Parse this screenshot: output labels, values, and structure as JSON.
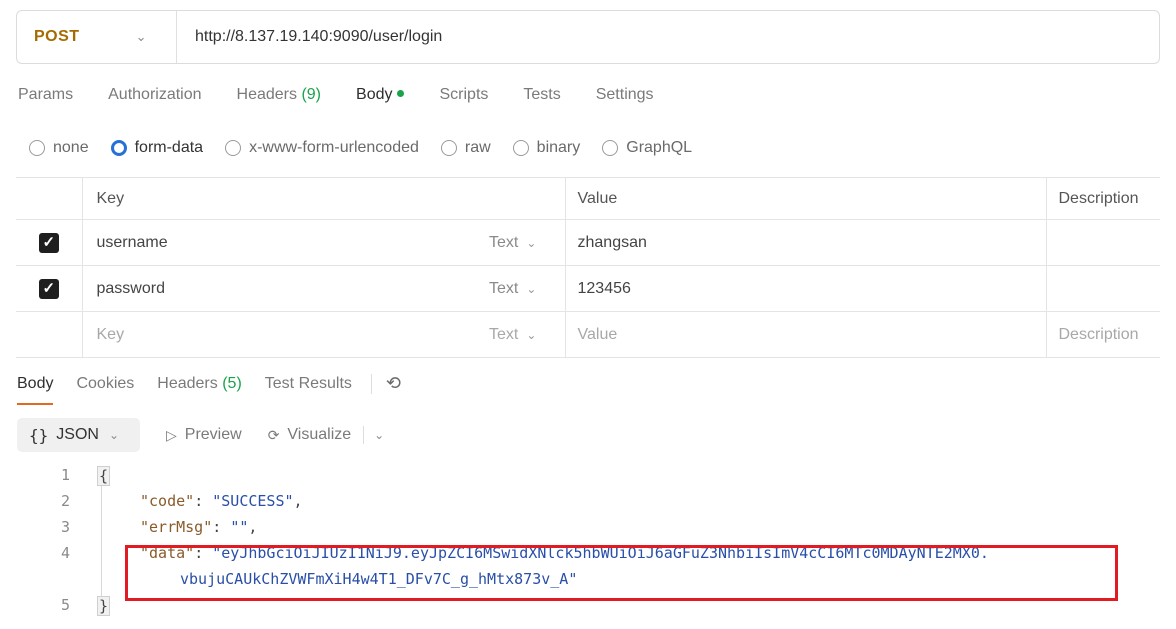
{
  "request": {
    "method": "POST",
    "url": "http://8.137.19.140:9090/user/login"
  },
  "request_tabs": [
    {
      "label": "Params"
    },
    {
      "label": "Authorization"
    },
    {
      "label": "Headers",
      "count": "(9)"
    },
    {
      "label": "Body"
    },
    {
      "label": "Scripts"
    },
    {
      "label": "Tests"
    },
    {
      "label": "Settings"
    }
  ],
  "body_types": [
    "none",
    "form-data",
    "x-www-form-urlencoded",
    "raw",
    "binary",
    "GraphQL"
  ],
  "body_type_selected": "form-data",
  "table": {
    "headers": {
      "key": "Key",
      "value": "Value",
      "description": "Description"
    },
    "rows": [
      {
        "checked": true,
        "key": "username",
        "type": "Text",
        "value": "zhangsan",
        "description": ""
      },
      {
        "checked": true,
        "key": "password",
        "type": "Text",
        "value": "123456",
        "description": ""
      }
    ],
    "new_row": {
      "key_placeholder": "Key",
      "type": "Text",
      "value_placeholder": "Value",
      "description_placeholder": "Description"
    }
  },
  "response_tabs": [
    {
      "label": "Body"
    },
    {
      "label": "Cookies"
    },
    {
      "label": "Headers",
      "count": "(5)"
    },
    {
      "label": "Test Results"
    }
  ],
  "format_bar": {
    "format": "JSON",
    "preview": "Preview",
    "visualize": "Visualize"
  },
  "code": {
    "line_numbers": [
      "1",
      "2",
      "3",
      "4",
      "5"
    ],
    "open_brace": "{",
    "close_brace": "}",
    "code_key": "\"code\"",
    "code_val": "\"SUCCESS\"",
    "errmsg_key": "\"errMsg\"",
    "errmsg_val": "\"\"",
    "data_key": "\"data\"",
    "data_val_line1": "\"eyJhbGciOiJIUzI1NiJ9.eyJpZCI6MSwidXNlck5hbWUiOiJ6aGFuZ3NhbiIsImV4cCI6MTc0MDAyNTE2MX0.",
    "data_val_line2": "vbujuCAUkChZVWFmXiH4w4T1_DFv7C_g_hMtx873v_A\""
  },
  "colors": {
    "highlight_border": "#e21b23",
    "accent_orange": "#e06a1e",
    "green": "#1aa34a",
    "radio_blue": "#2670d8"
  }
}
